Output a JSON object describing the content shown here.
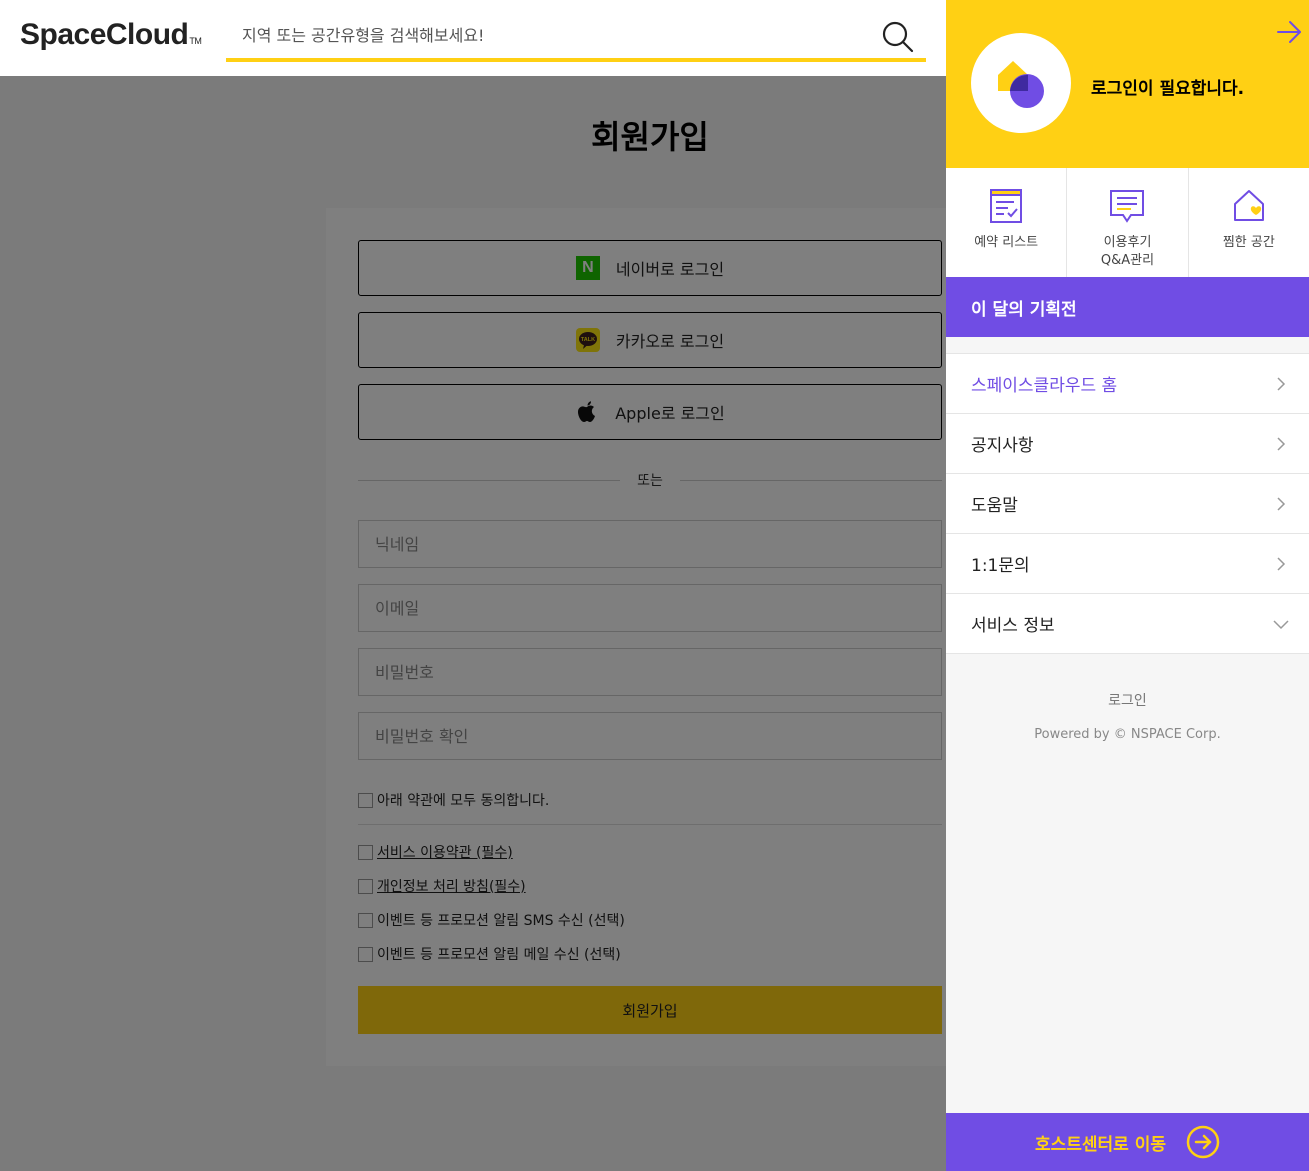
{
  "header": {
    "logo": "SpaceCloud",
    "logo_tm": "TM",
    "search_placeholder": "지역 또는 공간유형을 검색해보세요!",
    "search_icon": "search-icon"
  },
  "signup": {
    "title": "회원가입",
    "naver_label": "네이버로 로그인",
    "kakao_label": "카카오로 로그인",
    "apple_label": "Apple로 로그인",
    "naver_icon_text": "N",
    "kakao_icon_text": "TALK",
    "or_text": "또는",
    "nickname_placeholder": "닉네임",
    "email_placeholder": "이메일",
    "password_placeholder": "비밀번호",
    "password_confirm_placeholder": "비밀번호 확인",
    "agree_all": "아래 약관에 모두 동의합니다.",
    "terms": [
      "서비스 이용약관 (필수)",
      "개인정보 처리 방침(필수)",
      "이벤트 등 프로모션 알림 SMS 수신 (선택)",
      "이벤트 등 프로모션 알림 메일 수신 (선택)"
    ],
    "submit_label": "회원가입"
  },
  "drawer": {
    "login_needed": "로그인이 필요합니다.",
    "quick": [
      {
        "label": "예약 리스트",
        "icon": "reservation-list-icon"
      },
      {
        "label": "이용후기\nQ&A관리",
        "icon": "review-icon"
      },
      {
        "label": "찜한 공간",
        "icon": "wishlist-home-icon"
      }
    ],
    "promo": "이 달의 기획전",
    "menu": [
      {
        "label": "스페이스클라우드 홈",
        "active": true
      },
      {
        "label": "공지사항"
      },
      {
        "label": "도움말"
      },
      {
        "label": "1:1문의"
      },
      {
        "label": "서비스 정보"
      }
    ],
    "login_link": "로그인",
    "powered": "Powered by © NSPACE Corp.",
    "host_center": "호스트센터로 이동"
  },
  "colors": {
    "brand_yellow": "#ffd014",
    "brand_purple": "#704de4",
    "naver_green": "#1ec800",
    "kakao_yellow": "#ffe812"
  }
}
